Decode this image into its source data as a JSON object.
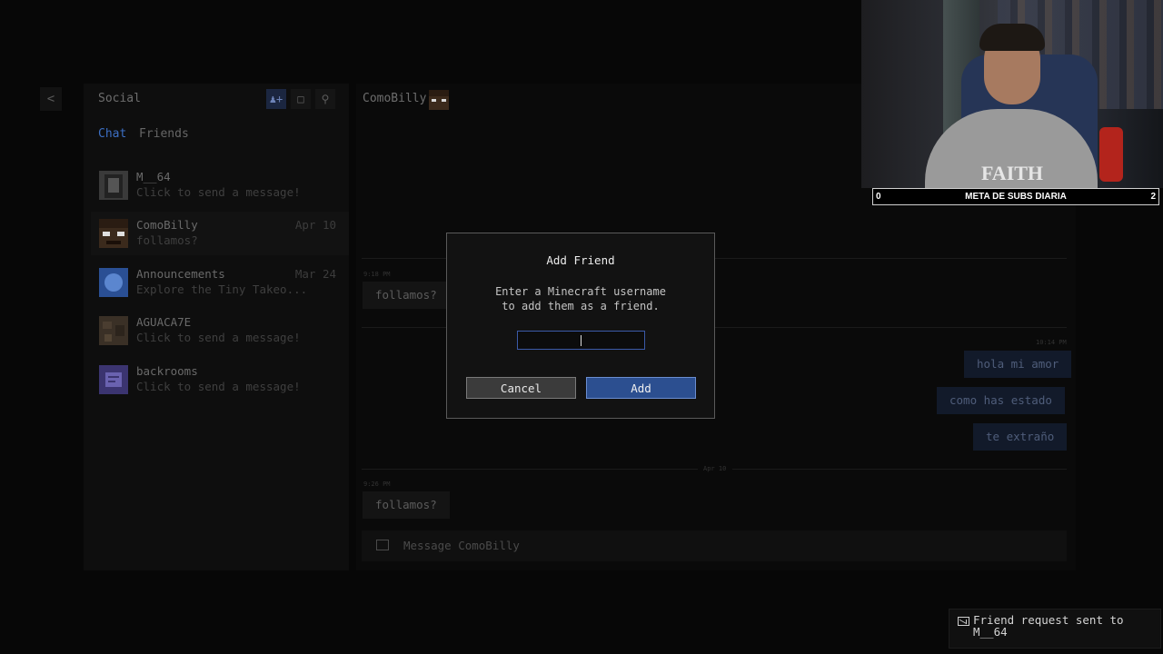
{
  "nav": {
    "back_glyph": "<"
  },
  "social": {
    "title": "Social",
    "icons": [
      "add-friend-icon",
      "new-chat-icon",
      "search-icon"
    ],
    "tabs": {
      "chat": "Chat",
      "friends": "Friends"
    },
    "conversations": [
      {
        "name": "M__64",
        "preview": "Click to send a message!",
        "date": ""
      },
      {
        "name": "ComoBilly",
        "preview": "follamos?",
        "date": "Apr 10"
      },
      {
        "name": "Announcements",
        "preview": "Explore the Tiny Takeo...",
        "date": "Mar 24"
      },
      {
        "name": "AGUACA7E",
        "preview": "Click to send a message!",
        "date": ""
      },
      {
        "name": "backrooms",
        "preview": "Click to send a message!",
        "date": ""
      }
    ]
  },
  "chat": {
    "user": "ComoBilly",
    "messages": {
      "m1": "follamos?",
      "m2": "hola mi amor",
      "m3": "como has estado",
      "m4": "te extraño",
      "m5": "follamos?"
    },
    "timestamps": {
      "t1": "9:18 PM",
      "t2": "10:14 PM",
      "t3": "9:26 PM"
    },
    "day_label": "Apr 10",
    "composer_placeholder": "Message ComoBilly"
  },
  "dialog": {
    "title": "Add Friend",
    "message_line1": "Enter a Minecraft username",
    "message_line2": "to add them as a friend.",
    "input_value": "",
    "cancel_label": "Cancel",
    "add_label": "Add"
  },
  "overlay": {
    "subs_min": "0",
    "subs_title": "META DE SUBS DIARIA",
    "subs_max": "2",
    "shirt_text": "FAITH"
  },
  "toast": {
    "text": "Friend request sent to M__64"
  },
  "colors": {
    "accent": "#3c6fc4",
    "add_button": "#2c4f90",
    "lamp": "#b3241c"
  }
}
